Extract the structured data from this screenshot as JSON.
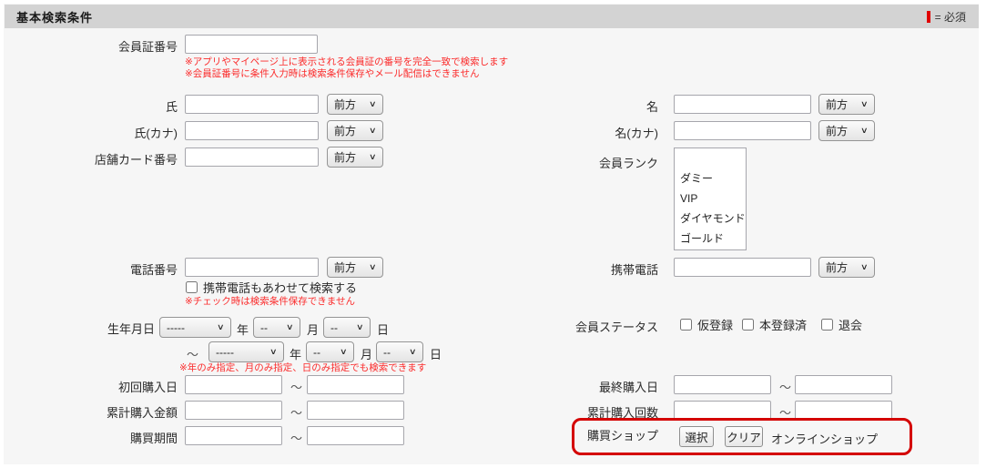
{
  "header": {
    "title": "基本検索条件",
    "required_legend": "= 必須"
  },
  "common": {
    "match_label": "前方",
    "tilde": "～",
    "year_suffix": "年",
    "month_suffix": "月",
    "day_suffix": "日",
    "year_placeholder": "-----",
    "md_placeholder": "--"
  },
  "member_card": {
    "label": "会員証番号",
    "value": "",
    "note1": "※アプリやマイページ上に表示される会員証の番号を完全一致で検索します",
    "note2": "※会員証番号に条件入力時は検索条件保存やメール配信はできません"
  },
  "last_name": {
    "label": "氏",
    "value": ""
  },
  "first_name": {
    "label": "名",
    "value": ""
  },
  "last_name_kana": {
    "label": "氏(カナ)",
    "value": ""
  },
  "first_name_kana": {
    "label": "名(カナ)",
    "value": ""
  },
  "store_card": {
    "label": "店舗カード番号",
    "value": ""
  },
  "member_rank": {
    "label": "会員ランク",
    "options": [
      "",
      "ダミー",
      "VIP",
      "ダイヤモンド",
      "ゴールド"
    ]
  },
  "phone": {
    "label": "電話番号",
    "value": "",
    "checkbox_label": "携帯電話もあわせて検索する",
    "note": "※チェック時は検索条件保存できません"
  },
  "mobile": {
    "label": "携帯電話",
    "value": ""
  },
  "birthdate": {
    "label": "生年月日",
    "note": "※年のみ指定、月のみ指定、日のみ指定でも検索できます"
  },
  "member_status": {
    "label": "会員ステータス",
    "options": [
      "仮登録",
      "本登録済",
      "退会"
    ]
  },
  "first_purchase": {
    "label": "初回購入日",
    "from": "",
    "to": ""
  },
  "last_purchase": {
    "label": "最終購入日",
    "from": "",
    "to": ""
  },
  "total_amount": {
    "label": "累計購入金額",
    "from": "",
    "to": ""
  },
  "total_count": {
    "label": "累計購入回数",
    "from": "",
    "to": ""
  },
  "purchase_period": {
    "label": "購買期間",
    "from": "",
    "to": ""
  },
  "purchase_shop": {
    "label": "購買ショップ",
    "select_button": "選択",
    "clear_button": "クリア",
    "value": "オンラインショップ"
  },
  "colors": {
    "required_red": "#e00000",
    "note_red": "#fb2b2b",
    "highlight_red": "#d40000",
    "titlebar_gray": "#d3d3d3",
    "panel_gray": "#f6f6f6"
  }
}
